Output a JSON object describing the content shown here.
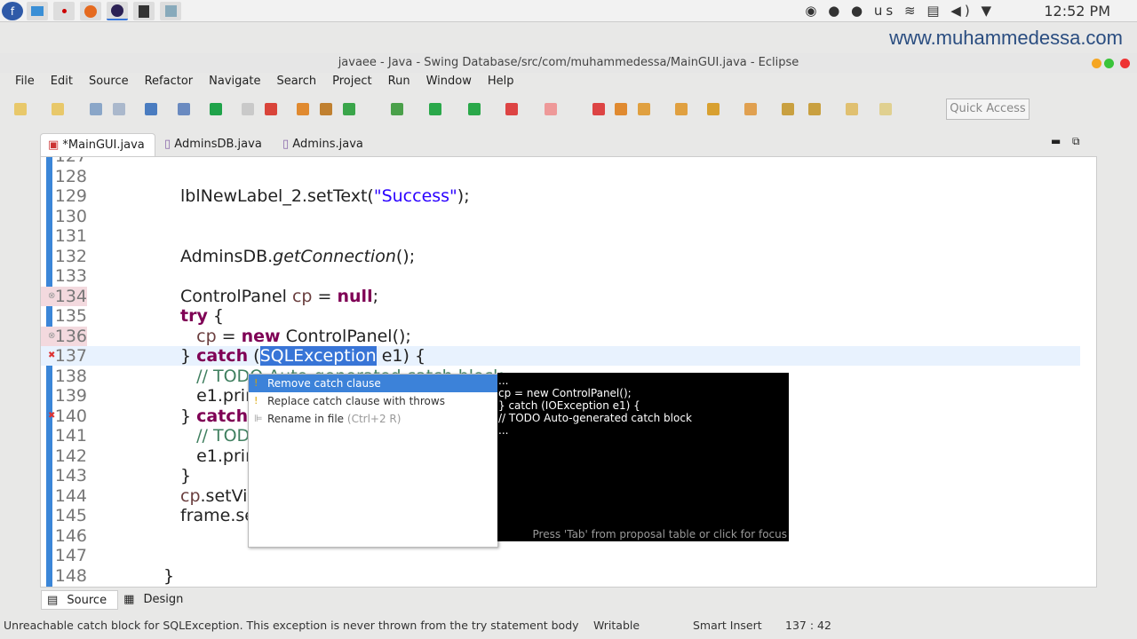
{
  "taskbar": {
    "apps": [
      "fedora-icon",
      "files-icon",
      "screenshot-icon",
      "firefox-icon",
      "eclipse-icon",
      "terminal-icon",
      "image-viewer-icon"
    ],
    "keyboard": "us",
    "clock": "12:52 PM"
  },
  "watermark": "www.muhammedessa.com",
  "window": {
    "title": "javaee - Java - Swing Database/src/com/muhammedessa/MainGUI.java - Eclipse"
  },
  "menu": [
    "File",
    "Edit",
    "Source",
    "Refactor",
    "Navigate",
    "Search",
    "Project",
    "Run",
    "Window",
    "Help"
  ],
  "toolbar": {
    "quick_access": "Quick Access"
  },
  "tabs": [
    {
      "label": "*MainGUI.java",
      "active": true
    },
    {
      "label": "AdminsDB.java"
    },
    {
      "label": "Admins.java"
    }
  ],
  "code": [
    {
      "n": "127",
      "t": []
    },
    {
      "n": "128",
      "t": []
    },
    {
      "n": "129",
      "t": [
        [
          "lblNewLabel_2.setText(",
          ""
        ],
        [
          "\"Success\"",
          "str"
        ],
        [
          ");",
          ""
        ]
      ]
    },
    {
      "n": "130",
      "t": []
    },
    {
      "n": "131",
      "t": []
    },
    {
      "n": "132",
      "t": [
        [
          "AdminsDB.",
          ""
        ],
        [
          "getConnection",
          "it"
        ],
        [
          "();",
          ""
        ]
      ]
    },
    {
      "n": "133",
      "t": []
    },
    {
      "n": "134",
      "warn": true,
      "t": [
        [
          "ControlPanel ",
          ""
        ],
        [
          "cp",
          "var"
        ],
        [
          " = ",
          ""
        ],
        [
          "null",
          "kw"
        ],
        [
          ";",
          ""
        ]
      ]
    },
    {
      "n": "135",
      "t": [
        [
          "try",
          "kw"
        ],
        [
          " {",
          ""
        ]
      ]
    },
    {
      "n": "136",
      "warn": true,
      "t": [
        [
          "   ",
          ""
        ],
        [
          "cp",
          "var"
        ],
        [
          " = ",
          ""
        ],
        [
          "new",
          "kw"
        ],
        [
          " ControlPanel();",
          ""
        ]
      ]
    },
    {
      "n": "137",
      "cur": true,
      "err": true,
      "t": [
        [
          "} ",
          ""
        ],
        [
          "catch",
          "kw"
        ],
        [
          " (",
          ""
        ],
        [
          "SQLException",
          "sel"
        ],
        [
          " e1) {",
          ""
        ]
      ]
    },
    {
      "n": "138",
      "t": [
        [
          "   ",
          ""
        ],
        [
          "// TODO Auto-generated catch block",
          "cm"
        ]
      ]
    },
    {
      "n": "139",
      "t": [
        [
          "   e1.printStackTrace();",
          ""
        ]
      ]
    },
    {
      "n": "140",
      "err": true,
      "t": [
        [
          "} ",
          ""
        ],
        [
          "catch",
          "kw"
        ],
        [
          " (IOException e1) {",
          ""
        ]
      ]
    },
    {
      "n": "141",
      "t": [
        [
          "   ",
          ""
        ],
        [
          "// TODO Auto-generated catch block",
          "cm"
        ]
      ]
    },
    {
      "n": "142",
      "t": [
        [
          "   e1.printStackTrace();",
          ""
        ]
      ]
    },
    {
      "n": "143",
      "t": [
        [
          "}",
          ""
        ]
      ]
    },
    {
      "n": "144",
      "t": [
        [
          "cp",
          "var"
        ],
        [
          ".setVisible(",
          ""
        ],
        [
          "true",
          "kw"
        ],
        [
          ");",
          ""
        ]
      ]
    },
    {
      "n": "145",
      "t": [
        [
          "frame",
          ""
        ],
        [
          ".setVisible(",
          ""
        ],
        [
          "false",
          "kw"
        ],
        [
          ");",
          ""
        ]
      ]
    },
    {
      "n": "146",
      "t": []
    },
    {
      "n": "147",
      "t": []
    },
    {
      "n": "148",
      "t": [
        [
          "}",
          ""
        ]
      ],
      "outdent": true
    }
  ],
  "quickfix": {
    "items": [
      {
        "label": "Remove catch clause",
        "selected": true,
        "icon": "quickfix-icon"
      },
      {
        "label": "Replace catch clause with throws",
        "icon": "quickfix-icon"
      },
      {
        "label": "Rename in file",
        "hint": "(Ctrl+2 R)",
        "icon": "rename-icon"
      }
    ],
    "preview": [
      "...",
      "cp = new ControlPanel();",
      "} catch (IOException e1) {",
      "// TODO Auto-generated catch block",
      "..."
    ],
    "footer": "Press 'Tab' from proposal table or click for focus"
  },
  "editor_tabs": [
    "Source",
    "Design"
  ],
  "status": {
    "message": "Unreachable catch block for SQLException. This exception is never thrown from the try statement body",
    "mode": "Writable",
    "insert": "Smart Insert",
    "position": "137 : 42"
  }
}
